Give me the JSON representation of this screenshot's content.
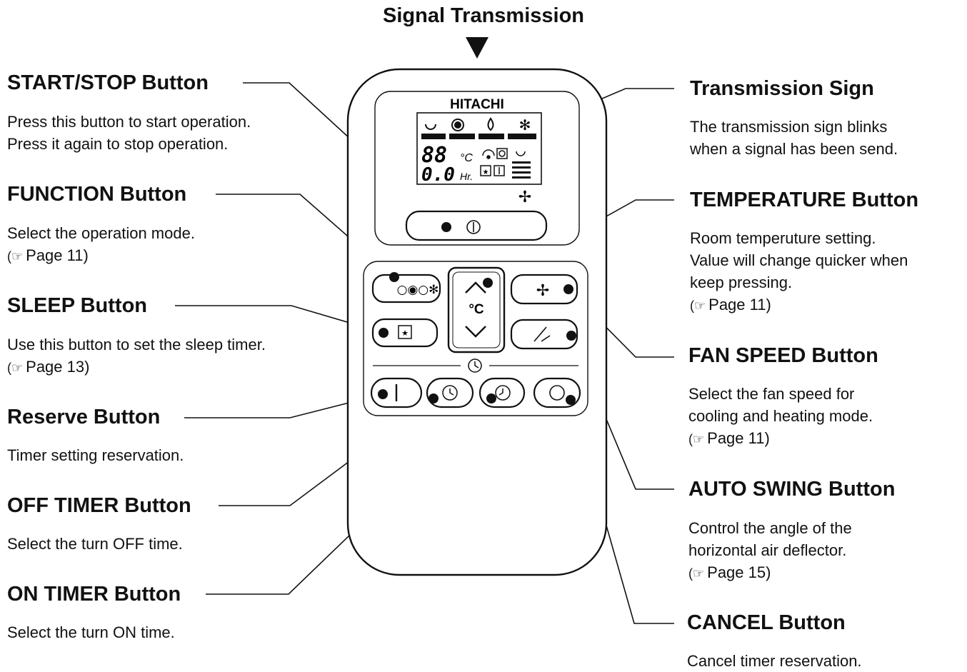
{
  "title": "Signal Transmission",
  "brand": "HITACHI",
  "lcd": {
    "digits": "88",
    "digits2": "0.0",
    "unit_c": "°C",
    "unit_hr": "Hr."
  },
  "remote": {
    "deg_c": "°C"
  },
  "labels": {
    "start_stop": {
      "heading": "START/STOP Button",
      "lines": [
        "Press this button to start operation.",
        "Press it again to stop operation."
      ]
    },
    "function": {
      "heading": "FUNCTION Button",
      "lines": [
        "Select the operation mode.",
        "Page 11)"
      ]
    },
    "sleep": {
      "heading": "SLEEP Button",
      "lines": [
        "Use this button to set the sleep timer.",
        "Page 13)"
      ]
    },
    "reserve": {
      "heading": "Reserve Button",
      "lines": [
        "Timer setting reservation."
      ]
    },
    "off_timer": {
      "heading": "OFF TIMER Button",
      "lines": [
        "Select the turn OFF time."
      ]
    },
    "on_timer": {
      "heading": "ON TIMER Button",
      "lines": [
        "Select the turn ON time."
      ]
    },
    "transmission_sign": {
      "heading": "Transmission Sign",
      "lines": [
        "The transmission sign blinks",
        "when a signal has been send."
      ]
    },
    "temperature": {
      "heading": "TEMPERATURE Button",
      "lines": [
        "Room temperuture setting.",
        "Value will change quicker when",
        "keep pressing.",
        "Page 11)"
      ]
    },
    "fan_speed": {
      "heading": "FAN SPEED Button",
      "lines": [
        "Select the fan speed for",
        "cooling and heating mode.",
        "Page 11)"
      ]
    },
    "auto_swing": {
      "heading": "AUTO SWING Button",
      "lines": [
        "Control the angle of the",
        "horizontal air deflector.",
        "Page 15)"
      ]
    },
    "cancel": {
      "heading": "CANCEL Button",
      "lines": [
        "Cancel timer reservation."
      ]
    }
  }
}
